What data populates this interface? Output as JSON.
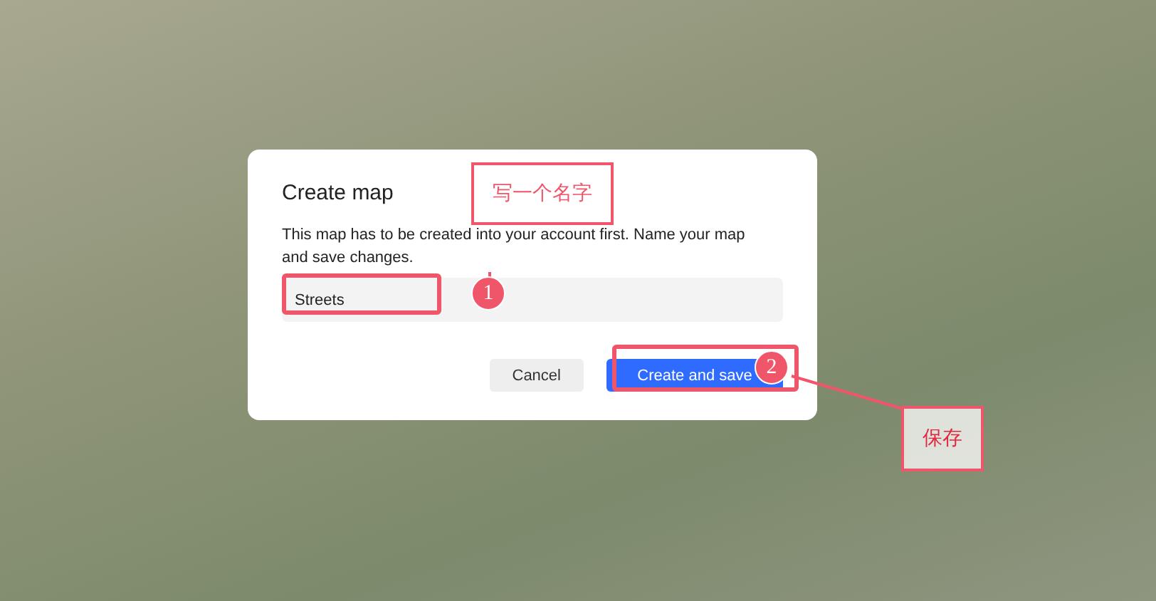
{
  "dialog": {
    "title": "Create map",
    "description": "This map has to be created into your account first. Name your map and save changes.",
    "name_field": {
      "value": "Streets"
    },
    "buttons": [
      {
        "label": "Cancel",
        "kind": "secondary"
      },
      {
        "label": "Create and save",
        "kind": "primary"
      }
    ]
  },
  "annotations": [
    {
      "number": "1",
      "label": "写一个名字"
    },
    {
      "number": "2",
      "label": "保存"
    }
  ]
}
